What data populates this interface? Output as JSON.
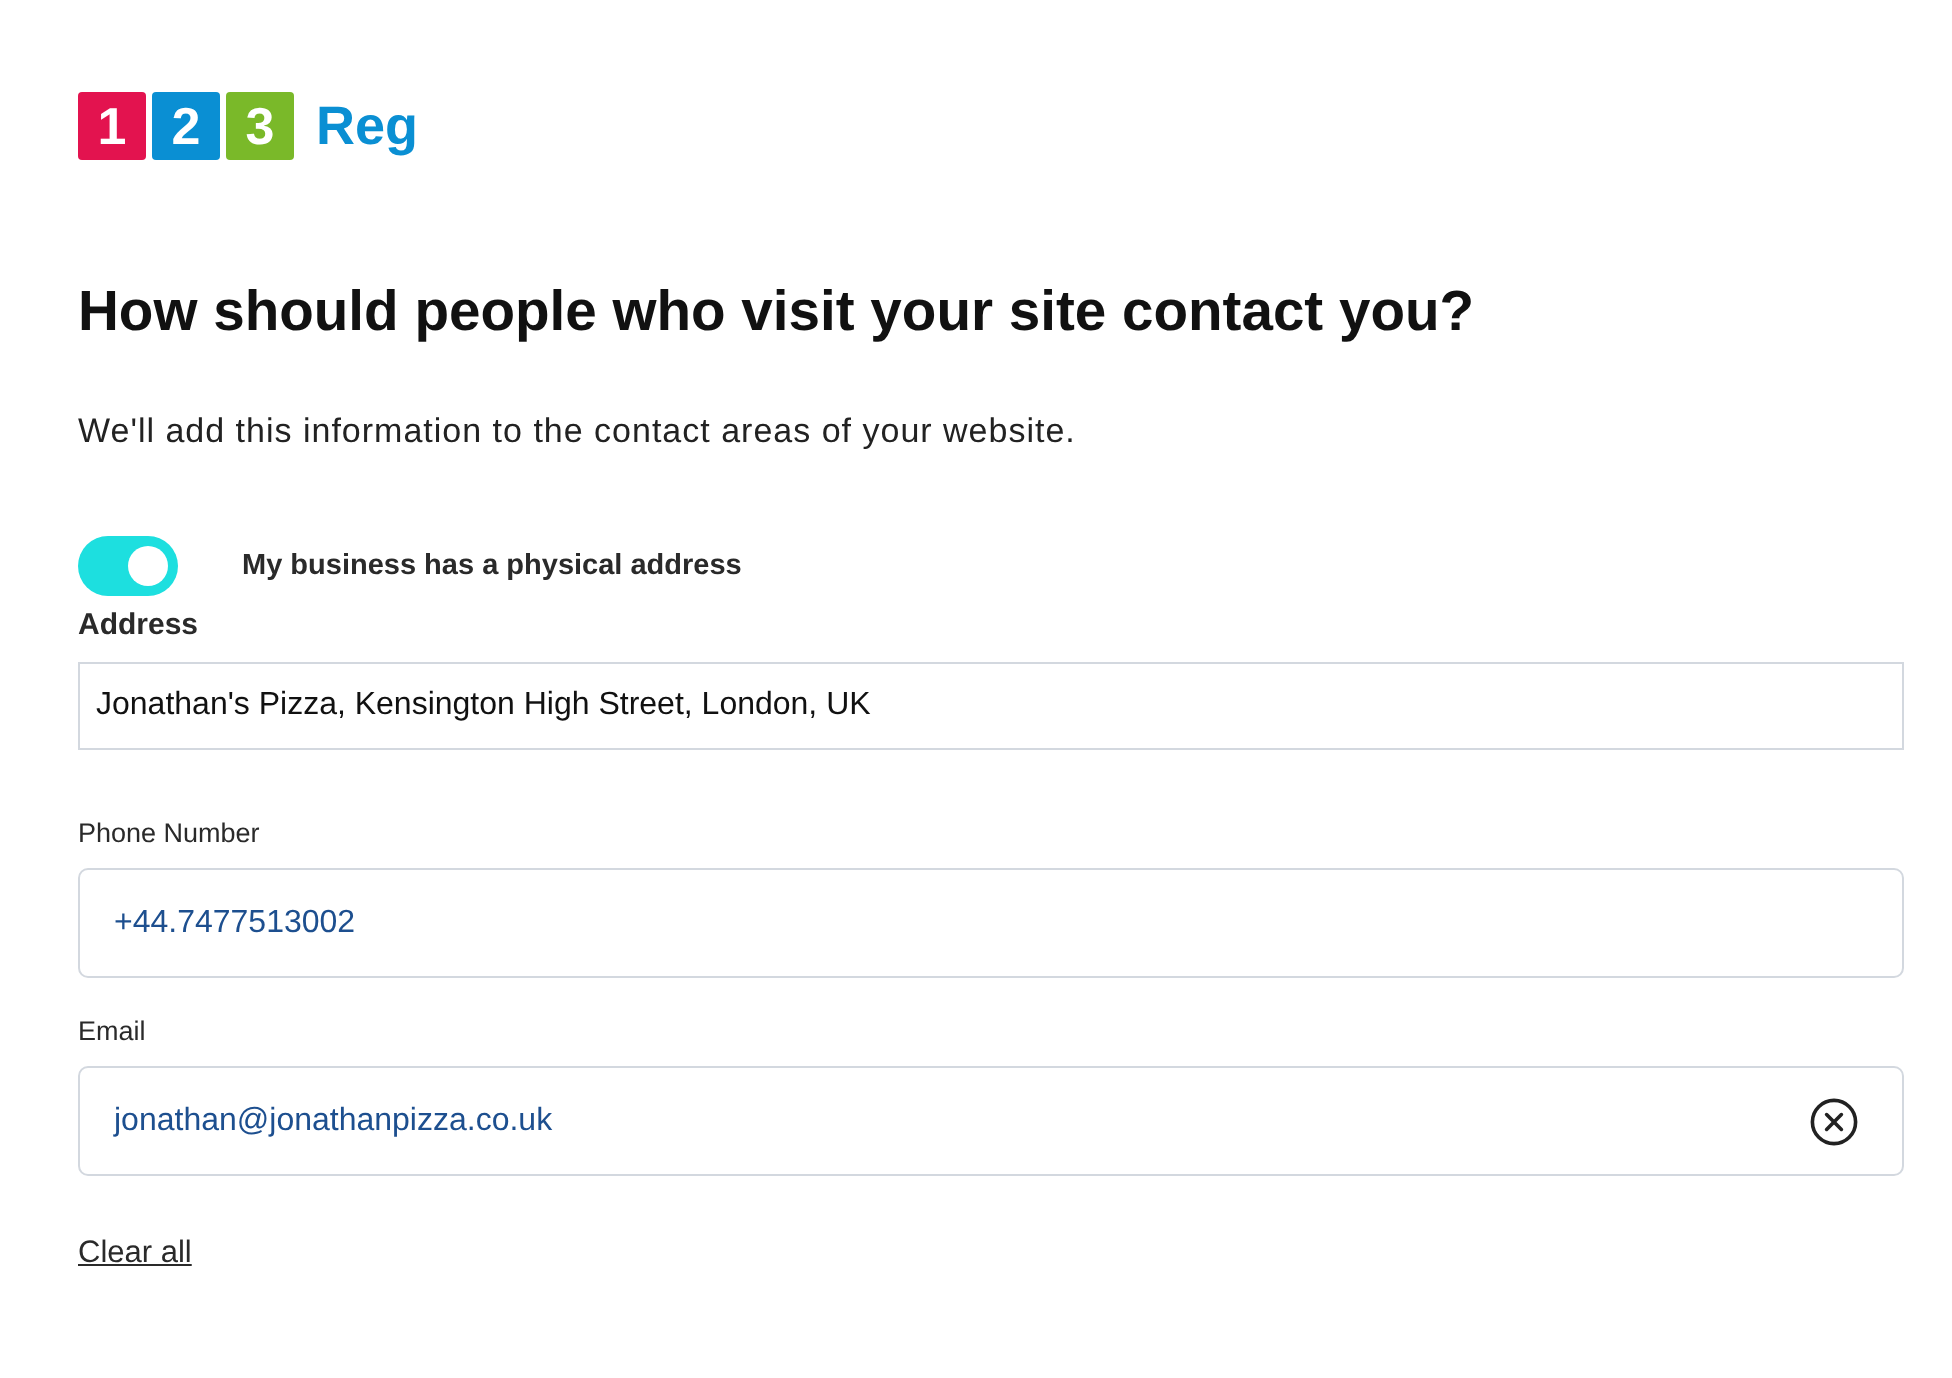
{
  "logo": {
    "tiles": [
      {
        "label": "1",
        "color": "#e3134f"
      },
      {
        "label": "2",
        "color": "#0a8fd3"
      },
      {
        "label": "3",
        "color": "#7ab929"
      }
    ],
    "wordmark": "Reg"
  },
  "heading": "How should people who visit your site contact you?",
  "subtitle": "We'll add this information to the contact areas of your website.",
  "address_toggle": {
    "label": "My business has a physical address",
    "on": true
  },
  "fields": [
    {
      "kind": "square",
      "label": "Address",
      "value": "Jonathan's Pizza, Kensington High Street, London, UK",
      "clearable": false
    },
    {
      "kind": "rounded",
      "label": "Phone Number",
      "value": "+44.7477513002",
      "clearable": false
    },
    {
      "kind": "rounded",
      "label": "Email",
      "value": "jonathan@jonathanpizza.co.uk",
      "clearable": true
    }
  ],
  "clear_all": "Clear all"
}
